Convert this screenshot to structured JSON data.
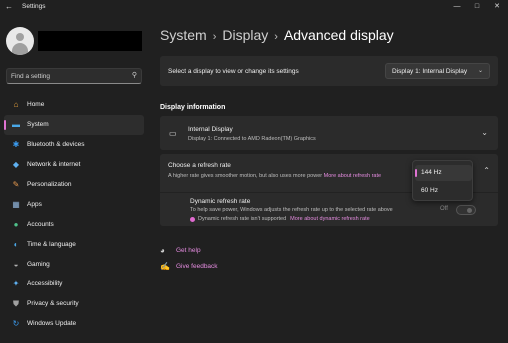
{
  "window": {
    "title": "Settings",
    "controls": [
      "—",
      "□",
      "✕"
    ]
  },
  "search": {
    "placeholder": "Find a setting"
  },
  "sidebar": {
    "items": [
      {
        "label": "Home",
        "icon": "home-icon",
        "color": "#e8a33d",
        "glyph": "⌂"
      },
      {
        "label": "System",
        "icon": "system-icon",
        "color": "#4aa8e8",
        "glyph": "▬",
        "active": true
      },
      {
        "label": "Bluetooth & devices",
        "icon": "bluetooth-icon",
        "color": "#3b9cf0",
        "glyph": "✱"
      },
      {
        "label": "Network & internet",
        "icon": "wifi-icon",
        "color": "#5fb0f0",
        "glyph": "◆"
      },
      {
        "label": "Personalization",
        "icon": "brush-icon",
        "color": "#e89a4f",
        "glyph": "✎"
      },
      {
        "label": "Apps",
        "icon": "apps-icon",
        "color": "#8fb3d9",
        "glyph": "▦"
      },
      {
        "label": "Accounts",
        "icon": "accounts-icon",
        "color": "#4fc18a",
        "glyph": "●"
      },
      {
        "label": "Time & language",
        "icon": "globe-clock-icon",
        "color": "#4aa8e8",
        "glyph": "◐"
      },
      {
        "label": "Gaming",
        "icon": "gamepad-icon",
        "color": "#b0b0b0",
        "glyph": "◒"
      },
      {
        "label": "Accessibility",
        "icon": "accessibility-icon",
        "color": "#5fb0f0",
        "glyph": "✦"
      },
      {
        "label": "Privacy & security",
        "icon": "shield-icon",
        "color": "#a0a0a0",
        "glyph": "⛊"
      },
      {
        "label": "Windows Update",
        "icon": "update-icon",
        "color": "#3b9cf0",
        "glyph": "↻"
      }
    ]
  },
  "breadcrumb": {
    "part1": "System",
    "part2": "Display",
    "current": "Advanced display",
    "separator": "›"
  },
  "display_select": {
    "label": "Select a display to view or change its settings",
    "value": "Display 1: Internal Display"
  },
  "display_info": {
    "heading": "Display information",
    "name": "Internal Display",
    "detail": "Display 1: Connected to AMD Radeon(TM) Graphics"
  },
  "refresh_rate": {
    "title": "Choose a refresh rate",
    "description": "A higher rate gives smoother motion, but also uses more power",
    "link": "More about refresh rate",
    "options": [
      "144 Hz",
      "60 Hz"
    ],
    "selected": "144 Hz"
  },
  "dynamic_refresh": {
    "title": "Dynamic refresh rate",
    "description": "To help save power, Windows adjusts the refresh rate up to the selected rate above",
    "warning": "Dynamic refresh rate isn't supported",
    "link": "More about dynamic refresh rate",
    "toggle_state": "Off"
  },
  "help": {
    "get_help": "Get help",
    "give_feedback": "Give feedback"
  },
  "colors": {
    "accent": "#e073d3",
    "link": "#e58ce0",
    "background": "#202020",
    "card": "#2b2b2b"
  }
}
